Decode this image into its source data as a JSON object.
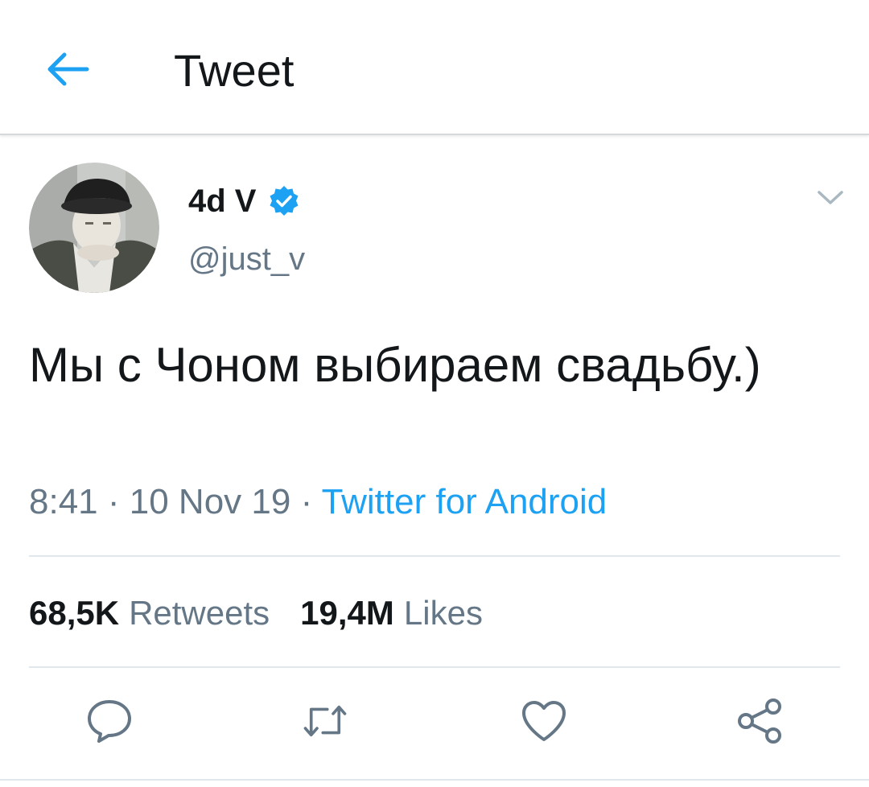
{
  "app_bar": {
    "back_icon": "arrow-left-icon",
    "title": "Tweet",
    "accent_color": "#1da1f2"
  },
  "tweet": {
    "author": {
      "display_name": "4d V",
      "handle": "@just_v",
      "verified": true,
      "avatar_icon": "avatar-photo"
    },
    "menu_icon": "chevron-down-icon",
    "text": "Мы с Чоном выбираем свадьбу.)",
    "time": "8:41",
    "separator": "·",
    "date": "10 Nov 19",
    "source": "Twitter for Android",
    "stats": {
      "retweets_count": "68,5K",
      "retweets_label": "Retweets",
      "likes_count": "19,4M",
      "likes_label": "Likes"
    },
    "actions": [
      "reply-icon",
      "retweet-icon",
      "like-icon",
      "share-icon"
    ]
  },
  "colors": {
    "text_primary": "#14171a",
    "text_secondary": "#657786",
    "link": "#1da1f2",
    "divider": "#e1e8ed"
  }
}
